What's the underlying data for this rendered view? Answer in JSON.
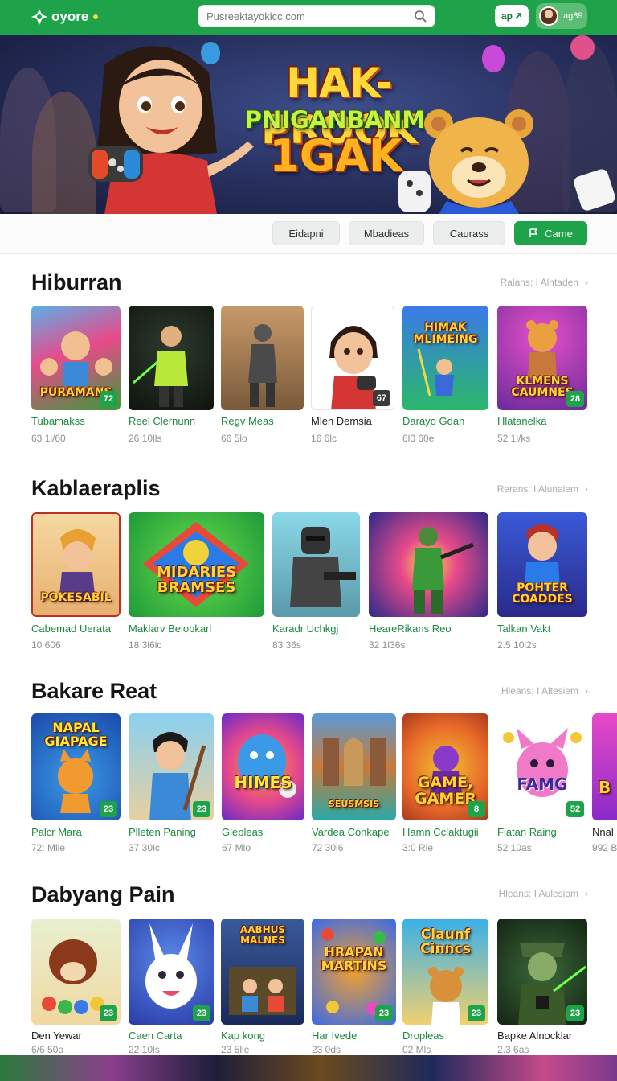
{
  "header": {
    "logo_text": "oyore",
    "search_placeholder": "Pusreektayokicc.com",
    "apk_label": "ap",
    "user_name": "ag89"
  },
  "hero": {
    "title_line1": "HAK-PROOK",
    "title_line2": "PNIGANBANM",
    "title_line3": "1GAK"
  },
  "filters": [
    {
      "label": "Eidapni"
    },
    {
      "label": "Mbadieas"
    },
    {
      "label": "Caurass"
    },
    {
      "label": "Came"
    }
  ],
  "sections": [
    {
      "title": "Hiburran",
      "more": "Ralans: I Alntaden",
      "cards": [
        {
          "title": "Tubamakss",
          "meta": "63 1l/60",
          "art": "PURAMANS",
          "badge": "72"
        },
        {
          "title": "Reel Clernunn",
          "meta": "26 10lls",
          "art": "",
          "badge": ""
        },
        {
          "title": "Regv Meas",
          "meta": "66 5lo",
          "art": "",
          "badge": ""
        },
        {
          "title": "Mlen Demsia",
          "meta": "16 6lc",
          "art": "",
          "badge": "67"
        },
        {
          "title": "Darayo Gdan",
          "meta": "6l0 60e",
          "art": "HIMAK MLIMEING",
          "badge": ""
        },
        {
          "title": "Hlatanelka",
          "meta": "52 1l/ks",
          "art": "KLMENS CAUMNES",
          "badge": "28"
        }
      ]
    },
    {
      "title": "Kablaeraplis",
      "more": "Rerans: I Alunaiem",
      "cards": [
        {
          "title": "Cabemad Uerata",
          "meta": "10 606",
          "art": "POKESABIL",
          "badge": ""
        },
        {
          "title": "Maklarv Belobkarl",
          "meta": "18 3l6lc",
          "art": "MIDARIES BRAMSES",
          "badge": ""
        },
        {
          "title": "Karadr Uchkgj",
          "meta": "83 36s",
          "art": "",
          "badge": ""
        },
        {
          "title": "HeareRikans Reo",
          "meta": "32 1l36s",
          "art": "",
          "badge": ""
        },
        {
          "title": "Talkan Vakt",
          "meta": "2.5 10l2s",
          "art": "POHTER COADDES",
          "badge": ""
        }
      ]
    },
    {
      "title": "Bakare Reat",
      "more": "Hleans: I Altesiem",
      "cards": [
        {
          "title": "Palcr Mara",
          "meta": "72: Mlle",
          "art": "NAPAL GIAPAGE",
          "badge": "23"
        },
        {
          "title": "Plleten Paning",
          "meta": "37 30lc",
          "art": "",
          "badge": "23"
        },
        {
          "title": "Glepleas",
          "meta": "67 Mlo",
          "art": "HIMES",
          "badge": ""
        },
        {
          "title": "Vardea Conkape",
          "meta": "72 30l6",
          "art": "SEUSMSIS",
          "badge": ""
        },
        {
          "title": "Hamn Cclaktugii",
          "meta": "3:0 Rle",
          "art": "GAME, GAMER",
          "badge": "8"
        },
        {
          "title": "Flatan Raing",
          "meta": "52 10as",
          "art": "FAMG",
          "badge": "52"
        },
        {
          "title": "Nnal",
          "meta": "992 B",
          "art": "B",
          "badge": ""
        }
      ]
    },
    {
      "title": "Dabyang Pain",
      "more": "Hleans: I Aulesiom",
      "cards": [
        {
          "title": "Den Yewar",
          "meta": "6/6 50o",
          "art": "",
          "badge": "23"
        },
        {
          "title": "Caen Carta",
          "meta": "22 10ls",
          "art": "",
          "badge": "23"
        },
        {
          "title": "Kap kong",
          "meta": "23 5lle",
          "art": "AABHUS MALNES",
          "badge": ""
        },
        {
          "title": "Har Ivede",
          "meta": "23 0ds",
          "art": "HRAPAN MARTINS",
          "badge": "23"
        },
        {
          "title": "Dropleas",
          "meta": "02 Mls",
          "art": "Claunf Cinncs",
          "badge": "23"
        },
        {
          "title": "Bapke Alnocklar",
          "meta": "2.3 6as",
          "art": "",
          "badge": "23"
        }
      ]
    }
  ],
  "colors": {
    "brand_green": "#1ea34a",
    "title_green": "#1b8a3f",
    "meta_gray": "#8d918e"
  }
}
